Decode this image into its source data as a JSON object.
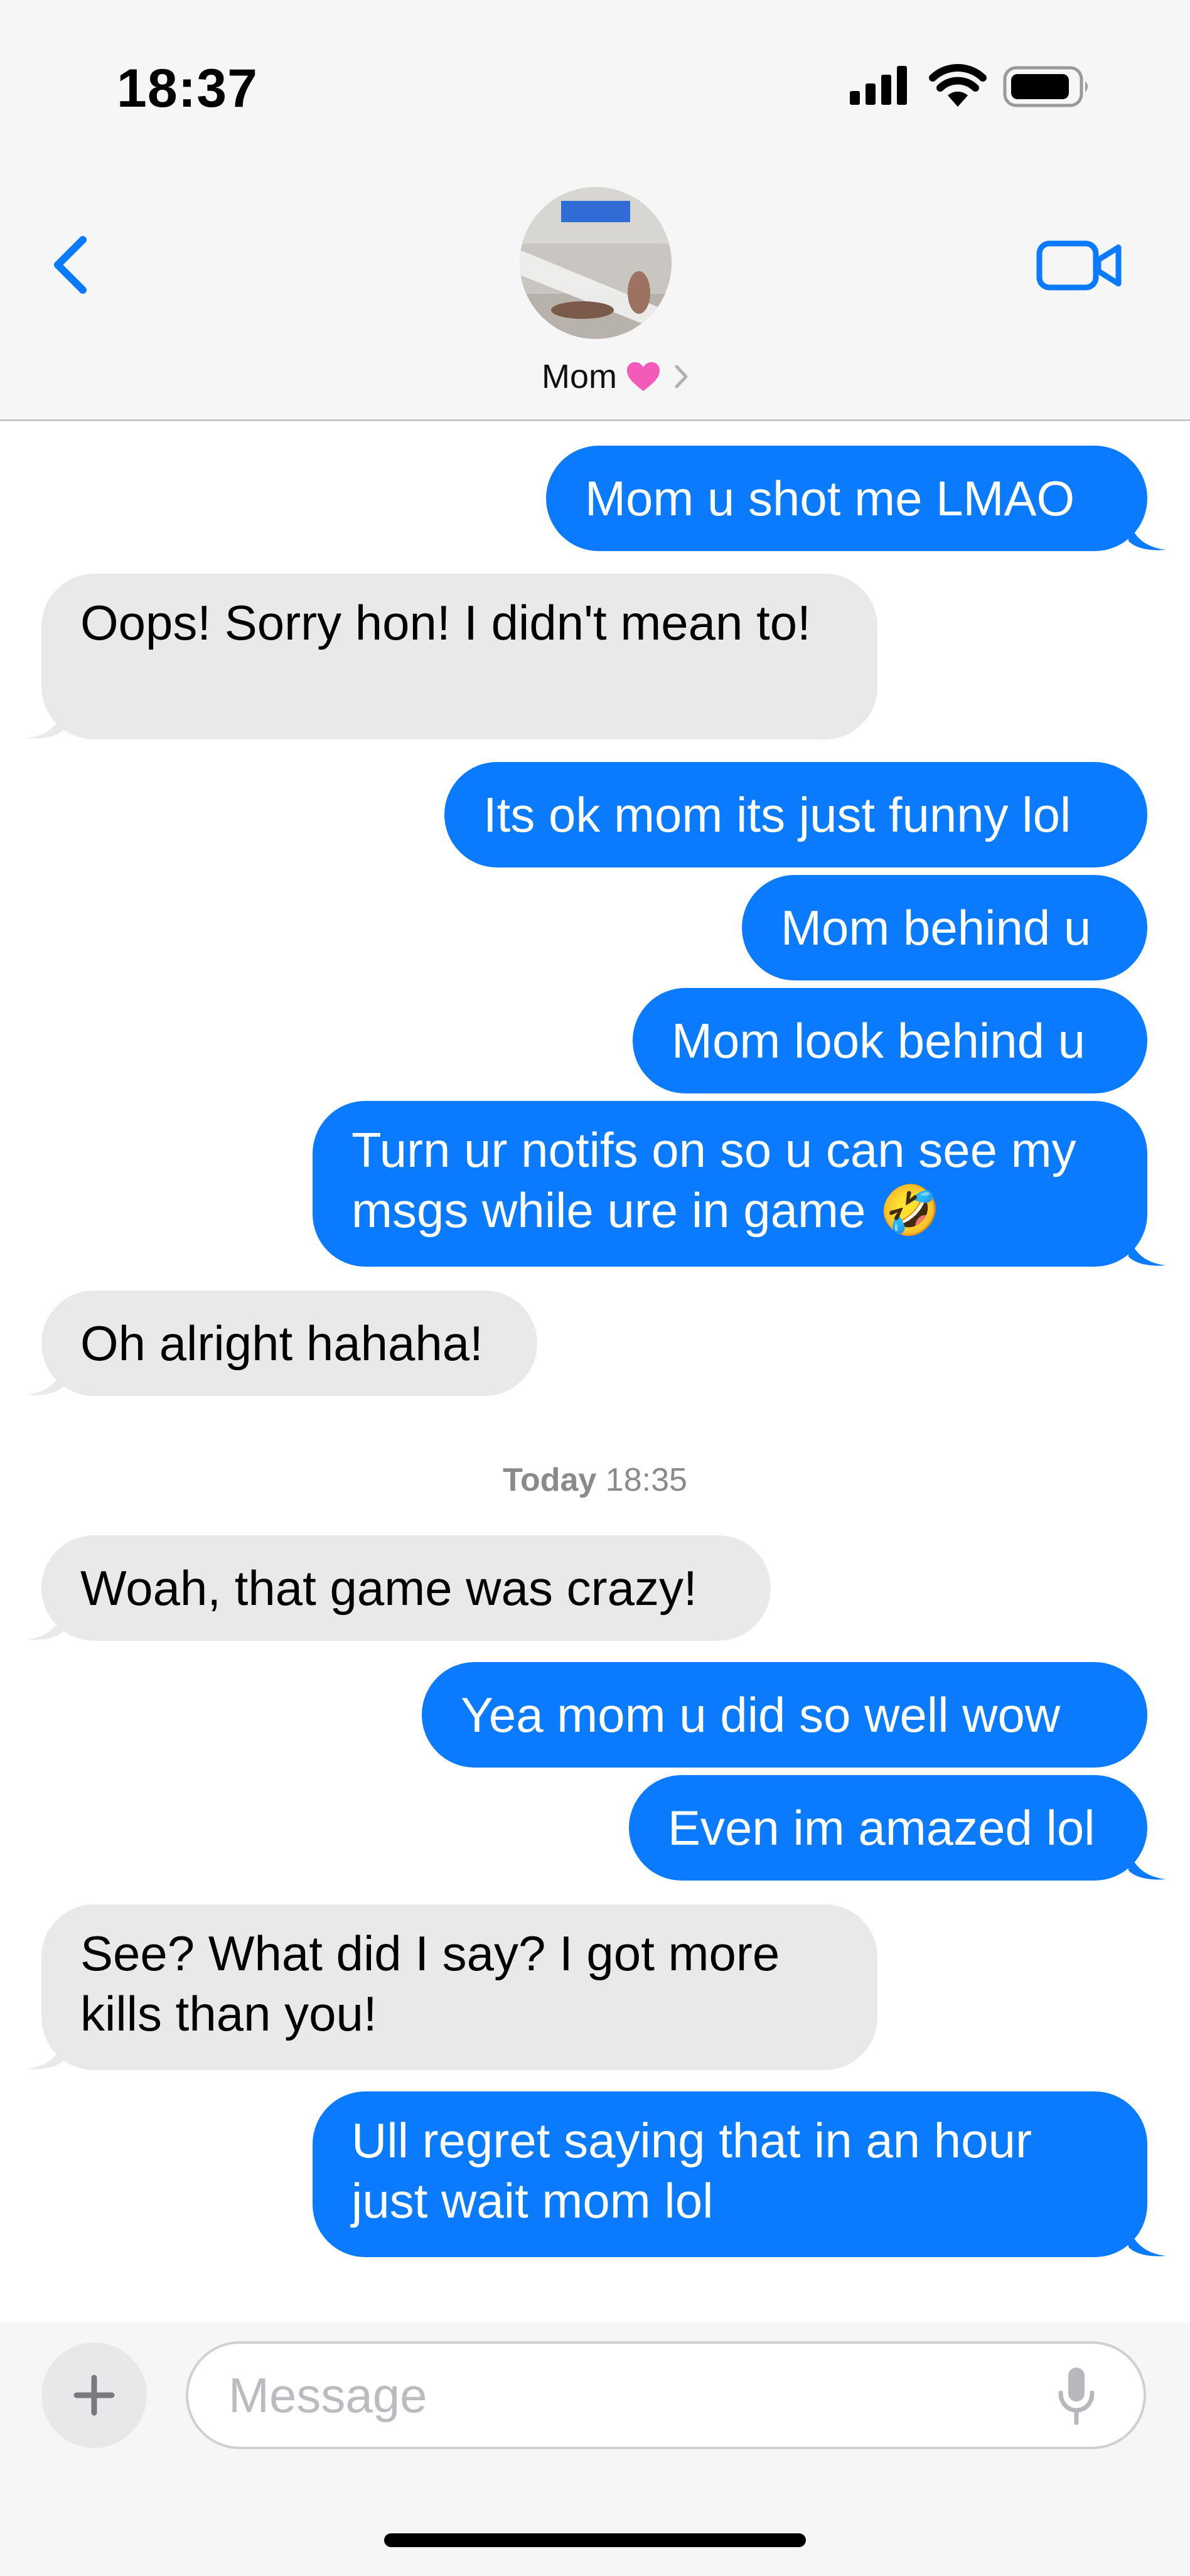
{
  "status_bar": {
    "time": "18:37",
    "icons": [
      "signal-icon",
      "wifi-icon",
      "battery-icon"
    ]
  },
  "nav": {
    "back_icon": "chevron-left-icon",
    "video_icon": "video-camera-icon",
    "contact": {
      "name": "Mom",
      "emoji_icon": "pink-heart-icon",
      "chevron_icon": "chevron-right-icon"
    }
  },
  "thread": {
    "timestamp": {
      "day": "Today",
      "time": "18:35"
    },
    "messages": [
      {
        "from": "me",
        "text": "Mom u shot me LMAO"
      },
      {
        "from": "them",
        "text": "Oops! Sorry hon! I didn't mean to!"
      },
      {
        "from": "me",
        "text": "Its ok mom its just funny lol"
      },
      {
        "from": "me",
        "text": "Mom behind u"
      },
      {
        "from": "me",
        "text": "Mom look behind u"
      },
      {
        "from": "me",
        "text": "Turn ur notifs on so u can see my msgs while ure in game 🤣"
      },
      {
        "from": "them",
        "text": "Oh alright hahaha!"
      },
      {
        "from": "them",
        "text": "Woah, that game was crazy!"
      },
      {
        "from": "me",
        "text": "Yea mom u did so well wow"
      },
      {
        "from": "me",
        "text": "Even im amazed lol"
      },
      {
        "from": "them",
        "text": "See? What did I say? I got more kills than you!"
      },
      {
        "from": "me",
        "text": "Ull regret saying that in an hour just wait mom lol"
      }
    ]
  },
  "composer": {
    "placeholder": "Message",
    "plus_icon": "plus-icon",
    "mic_icon": "microphone-icon"
  },
  "colors": {
    "outgoing_bubble": "#0a7bff",
    "incoming_bubble": "#e9e9eb",
    "accent": "#0a7bff"
  }
}
